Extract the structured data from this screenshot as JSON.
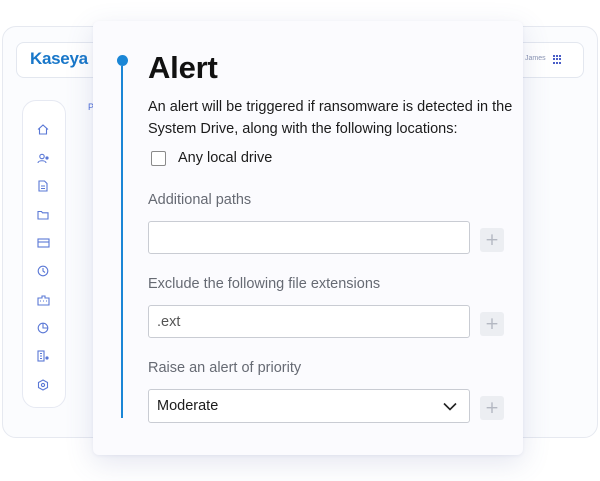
{
  "background_app": {
    "logo": "Kaseya",
    "user_name": "James",
    "breadcrumb": "P",
    "sidebar_icons": [
      "home-icon",
      "users-icon",
      "document-icon",
      "folder-icon",
      "card-icon",
      "clock-icon",
      "building-icon",
      "chart-icon",
      "office-icon",
      "settings-icon"
    ]
  },
  "alert_card": {
    "title": "Alert",
    "description": "An alert will be triggered if ransomware is detected in the System Drive, along with the following locations:",
    "any_local_drive": {
      "label": "Any local drive",
      "checked": false
    },
    "additional_paths": {
      "label": "Additional paths",
      "value": "",
      "add_label": "+"
    },
    "exclude_extensions": {
      "label": "Exclude the following file extensions",
      "placeholder": ".ext",
      "add_label": "+"
    },
    "priority": {
      "label": "Raise an alert of priority",
      "selected": "Moderate",
      "add_label": "+"
    }
  },
  "colors": {
    "accent": "#1a86d6",
    "logo": "#1877c9",
    "sidebar_icon": "#5a78d6"
  }
}
